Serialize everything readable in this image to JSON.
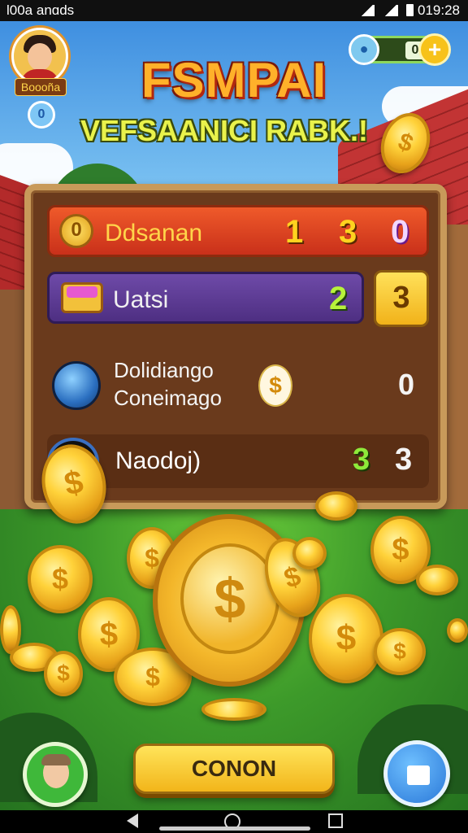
{
  "status_bar": {
    "left_text": "Ɩ00a anɑds",
    "right_text": "019:28"
  },
  "player": {
    "name": "Boooña"
  },
  "currency": {
    "value": "0",
    "plus_label": "+"
  },
  "title": {
    "line1": "FSMPAI",
    "line2": "VEFSAANICI RABK.!"
  },
  "leaderboard": {
    "row1": {
      "label": "Ddsanan",
      "values": [
        "1",
        "3",
        "0"
      ]
    },
    "row2": {
      "label": "Uatsi",
      "value": "2",
      "badge": "3"
    },
    "row3": {
      "line1": "Dolidiango",
      "line2": "Coneimago",
      "value": "0"
    },
    "row4": {
      "label": "Naodoj)",
      "values": [
        "3",
        "3"
      ]
    }
  },
  "coin_symbol": "$",
  "small_button_label": "0",
  "bottom": {
    "main_button_label": "CONON"
  },
  "colors": {
    "accent_gold": "#f7c21a",
    "row1_red": "#e04a22",
    "row2_purple": "#5c3a94",
    "panel_brown": "#6a3a1c"
  },
  "icons": [
    "wifi-icon",
    "signal-icon",
    "battery-icon",
    "gem-icon",
    "plus-icon",
    "coin-icon",
    "chest-icon",
    "helmet-icon",
    "bag-icon",
    "back-icon",
    "home-icon",
    "recents-icon"
  ]
}
